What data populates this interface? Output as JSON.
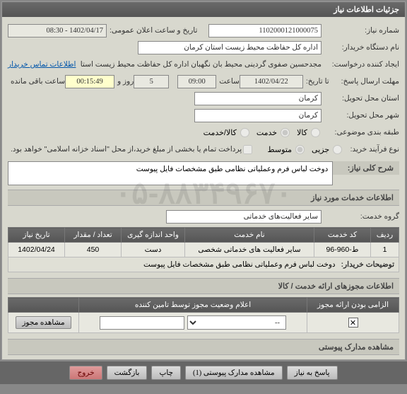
{
  "header": {
    "title": "جزئیات اطلاعات نیاز"
  },
  "fields": {
    "req_no_label": "شماره نیاز:",
    "req_no": "1102000121000075",
    "pub_time_label": "تاریخ و ساعت اعلان عمومی:",
    "pub_time": "1402/04/17 - 08:30",
    "buyer_label": "نام دستگاه خریدار:",
    "buyer": "اداره کل حفاظت محیط زیست استان کرمان",
    "creator_label": "ایجاد کننده درخواست:",
    "creator": "مجدحسین صفوی گردینی محیط بان نگهبان اداره کل حفاظت محیط زیست استا",
    "contact_link": "اطلاعات تماس خریدار",
    "deadline_label": "مهلت ارسال پاسخ:",
    "deadline_date_label": "تا تاریخ:",
    "deadline_date": "1402/04/22",
    "deadline_hour_label": "ساعت",
    "deadline_hour": "09:00",
    "days_label": "روز و",
    "days": "5",
    "countdown": "00:15:49",
    "remain_label": "ساعت باقی مانده",
    "prov_label": "استان محل تحویل:",
    "prov": "کرمان",
    "city_label": "شهر محل تحویل:",
    "city": "کرمان",
    "class_label": "طبقه بندی موضوعی:",
    "r_goods": "کالا",
    "r_service": "خدمت",
    "r_both": "کالا/خدمت",
    "buy_proc_label": "نوع فرآیند خرید:",
    "r_small": "جزیی",
    "r_medium": "متوسط",
    "pay_note": "پرداخت تمام یا بخشی از مبلغ خرید،از محل \"اسناد خزانه اسلامی\" خواهد بود.",
    "main_desc_label": "شرح کلی نیاز:",
    "main_desc": "دوخت لباس فرم وعملیاتی نظامی طبق مشخصات فایل پیوست",
    "svc_info_header": "اطلاعات خدمات مورد نیاز",
    "svc_group_label": "گروه خدمت:",
    "svc_group": "سایر فعالیت‌های خدماتی",
    "th_row": "ردیف",
    "th_code": "کد خدمت",
    "th_name": "نام خدمت",
    "th_unit": "واحد اندازه گیری",
    "th_qty": "تعداد / مقدار",
    "th_date": "تاریخ نیاز",
    "tr_row": "1",
    "tr_code": "ط-960-96",
    "tr_name": "سایر فعالیت های خدماتی شخصی",
    "tr_unit": "دست",
    "tr_qty": "450",
    "tr_date": "1402/04/24",
    "buyer_note_label": "توضیحات خریدار:",
    "buyer_note": "دوخت لباس فرم وعملیاتی نظامی طبق مشخصات فایل پیوست",
    "perm_header": "اطلاعات مجوزهای ارائه خدمت / کالا",
    "th2_req": "الزامی بودن ارائه مجوز",
    "th2_stat": "اعلام وضعیت مجوز توسط تامین کننده",
    "th2_empty": "",
    "td2_sel": "--",
    "td2_view": "مشاهده مجوز",
    "attach_header": "مشاهده مدارک پیوستی",
    "btn_reply": "پاسخ به نیاز",
    "btn_attach": "مشاهده مدارک پیوستی (1)",
    "btn_print": "چاپ",
    "btn_back": "بازگشت",
    "btn_exit": "خروج"
  }
}
